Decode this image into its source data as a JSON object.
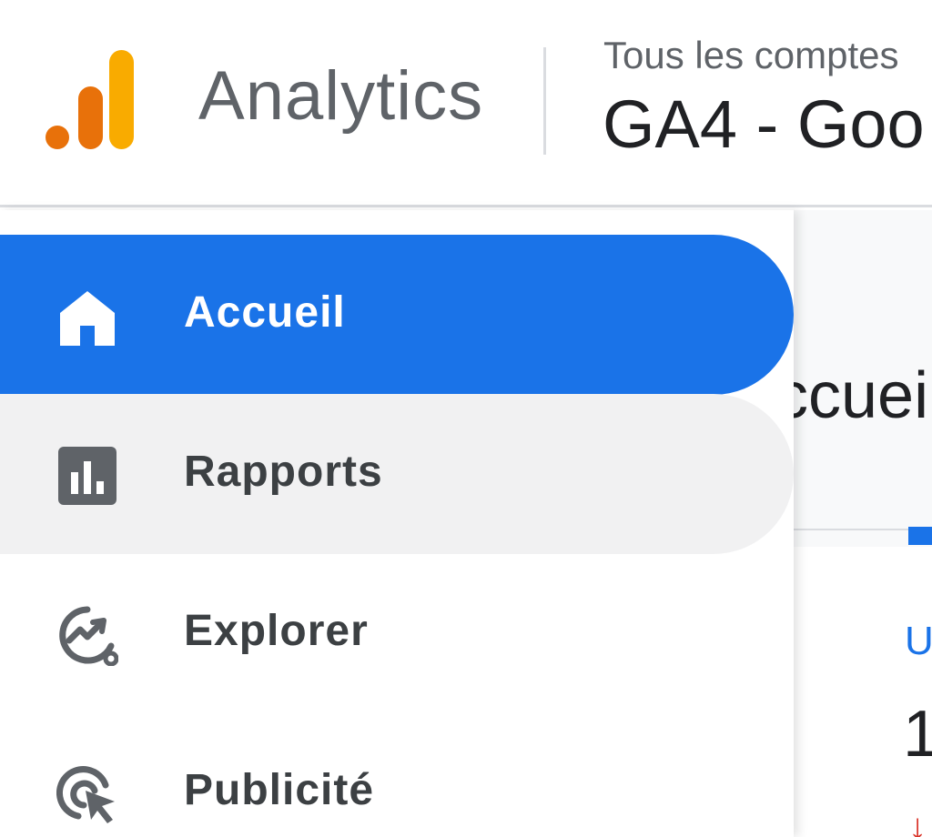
{
  "header": {
    "brand": "Analytics",
    "account_label": "Tous les comptes",
    "property_name": "GA4 - Goo"
  },
  "nav": {
    "items": [
      {
        "label": "Accueil",
        "icon": "home-icon",
        "state": "active"
      },
      {
        "label": "Rapports",
        "icon": "reports-icon",
        "state": "hover"
      },
      {
        "label": "Explorer",
        "icon": "explore-icon",
        "state": "normal"
      },
      {
        "label": "Publicité",
        "icon": "advertising-icon",
        "state": "normal"
      }
    ]
  },
  "main": {
    "page_title": "ccueil",
    "metric_label": "U",
    "metric_value": "1",
    "trend_icon": "↓"
  },
  "colors": {
    "accent": "#1a73e8",
    "logo_orange": "#e8710a",
    "logo_yellow": "#f9ab00",
    "icon_grey": "#5f6368",
    "hover_bg": "#f1f1f2"
  }
}
